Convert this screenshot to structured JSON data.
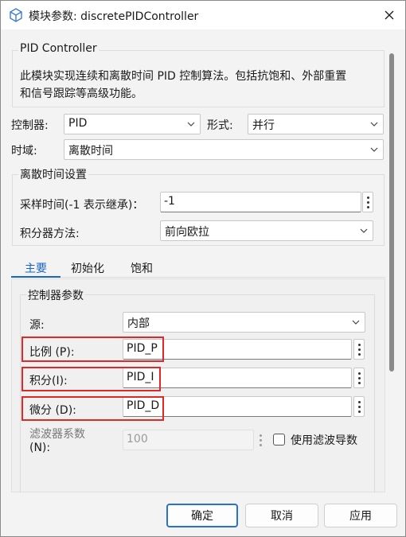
{
  "window": {
    "title": "模块参数: discretePIDController"
  },
  "description_group": {
    "legend": "PID Controller",
    "line1": "此模块实现连续和离散时间 PID 控制算法。包括抗饱和、外部重置",
    "line2": "和信号跟踪等高级功能。"
  },
  "controller": {
    "label": "控制器:",
    "value": "PID"
  },
  "form": {
    "label": "形式:",
    "value": "并行"
  },
  "time_domain": {
    "label": "时域:",
    "value": "离散时间"
  },
  "discrete_settings": {
    "legend": "离散时间设置",
    "sample_time_label": "采样时间(-1 表示继承)：",
    "sample_time_value": "-1",
    "integrator_method_label": "积分器方法:",
    "integrator_method_value": "前向欧拉"
  },
  "tabs": [
    {
      "label": "主要",
      "active": true
    },
    {
      "label": "初始化",
      "active": false
    },
    {
      "label": "饱和",
      "active": false
    }
  ],
  "controller_params": {
    "legend": "控制器参数",
    "source_label": "源:",
    "source_value": "内部",
    "p_label": "比例 (P):",
    "p_value": "PID_P",
    "i_label": "积分(I):",
    "i_value": "PID_I",
    "d_label": "微分 (D):",
    "d_value": "PID_D",
    "filter_label_line1": "滤波器系数",
    "filter_label_line2": "(N):",
    "filter_value": "100",
    "use_filter_derivative_label": "使用滤波导数",
    "use_filter_derivative_checked": false
  },
  "buttons": {
    "ok": "确定",
    "cancel": "取消",
    "apply": "应用"
  },
  "colors": {
    "accent": "#1a64c8",
    "highlight_box": "#e02828",
    "primary_button_border": "#2a6fd6"
  }
}
